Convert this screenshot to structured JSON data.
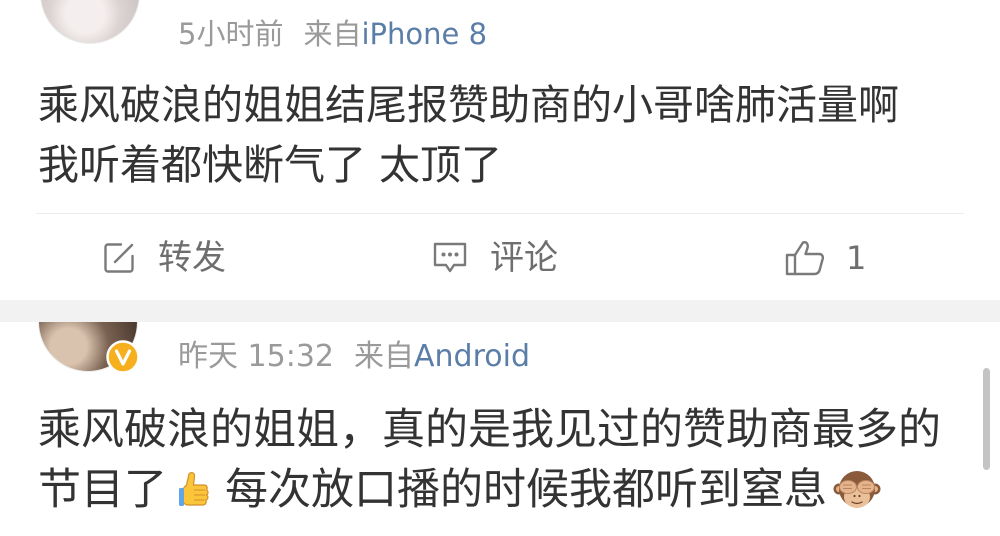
{
  "posts": [
    {
      "meta": {
        "time": "5小时前",
        "source_prefix": "来自",
        "source": "iPhone 8"
      },
      "text_lines": [
        "乘风破浪的姐姐结尾报赞助商的小哥啥肺活量啊",
        "我听着都快断气了 太顶了"
      ],
      "actions": {
        "repost_label": "转发",
        "repost_icon": "repost-icon",
        "comment_label": "评论",
        "comment_icon": "comment-icon",
        "like_icon": "like-icon",
        "like_count": "1"
      }
    },
    {
      "meta": {
        "time": "昨天 15:32",
        "source_prefix": "来自",
        "source": "Android"
      },
      "verified": true,
      "verified_badge_icon": "verified-badge-icon",
      "text_lines": [
        "乘风破浪的姐姐，真的是我见过的赞助商最多的"
      ],
      "text_line2": {
        "part1": "节目了",
        "emoji1_icon": "thumbs-up-icon",
        "part2": "每次放口播的时候我都听到窒息",
        "emoji2_icon": "see-no-evil-monkey-icon"
      }
    }
  ],
  "colors": {
    "text": "#333333",
    "meta": "#9a9a9a",
    "source_link": "#5b7ea8",
    "action": "#6e6e6e",
    "separator": "#f2f2f2",
    "divider": "#ebebeb",
    "verified_badge": "#f6b01e",
    "scrollbar": "#c4c4c4"
  }
}
